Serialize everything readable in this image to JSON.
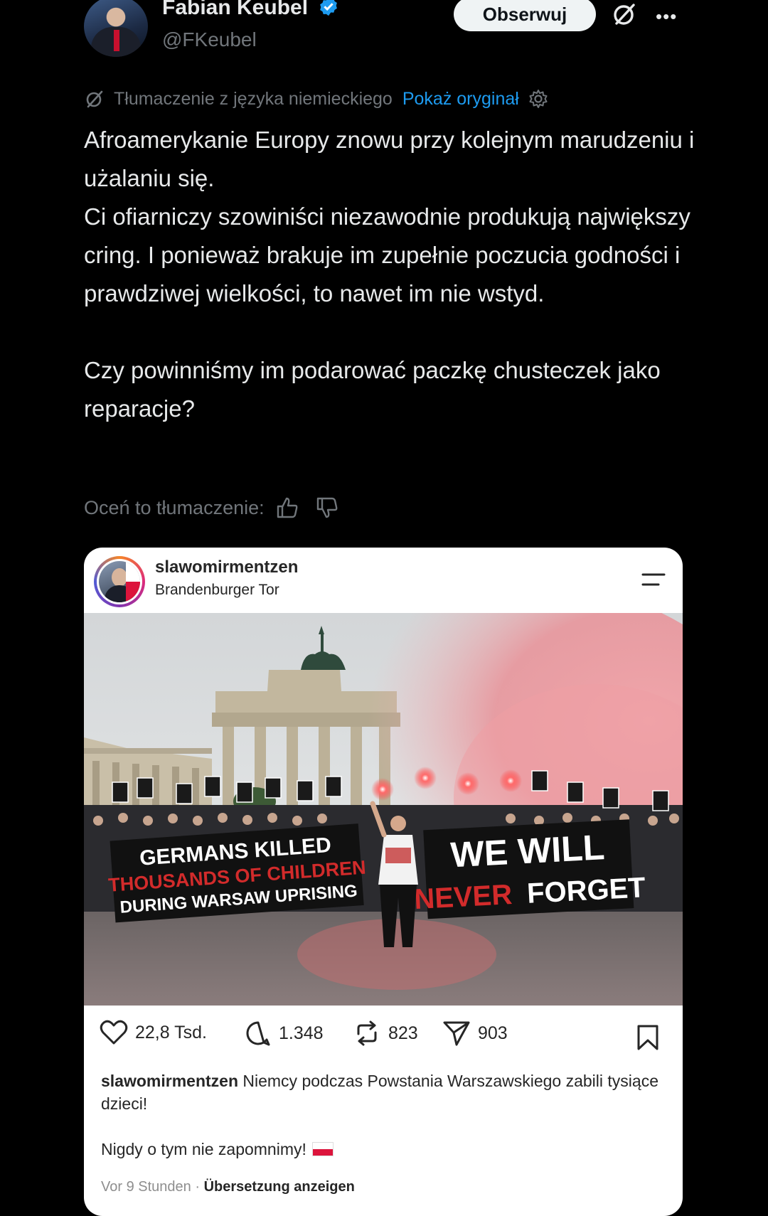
{
  "tweet": {
    "author_name": "Fabian Keubel",
    "handle": "@FKeubel",
    "follow_label": "Obserwuj",
    "more_label": "•••",
    "translation_note": "Tłumaczenie z języka niemieckiego",
    "show_original_label": "Pokaż oryginał",
    "text_lines_1": [
      "Afroamerykanie Europy znowu przy kolejnym marudzeniu i użalaniu się.",
      "Ci ofiarniczy szowiniści niezawodnie produkują największy cring. I ponieważ brakuje im zupełnie poczucia godności i prawdziwej wielkości, to nawet im nie wstyd."
    ],
    "text_para_2": "Czy powinniśmy im podarować paczkę chusteczek jako reparacje?",
    "rate_label": "Oceń to tłumaczenie:",
    "colors": {
      "background": "#000000",
      "link": "#1d9bf0",
      "muted": "#71767b"
    }
  },
  "instagram_post": {
    "username": "slawomirmentzen",
    "location": "Brandenburger Tor",
    "banner_left": [
      "GERMANS KILLED",
      "THOUSANDS OF CHILDREN",
      "DURING WARSAW UPRISING"
    ],
    "banner_right": [
      "WE WILL",
      "NEVER",
      "FORGET"
    ],
    "likes": "22,8 Tsd.",
    "comments": "1.348",
    "reposts": "823",
    "shares": "903",
    "caption_user": "slawomirmentzen",
    "caption_text": "Niemcy podczas Powstania Warszawskiego zabili tysiące dzieci!",
    "caption_text_2": "Nigdy o tym nie zapomnimy!",
    "time": "Vor 9 Stunden",
    "separator": " · ",
    "translate_label": "Übersetzung anzeigen"
  }
}
